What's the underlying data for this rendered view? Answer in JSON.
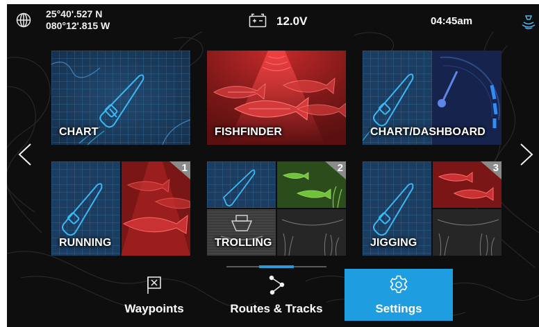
{
  "status": {
    "latitude": "25°40'.527 N",
    "longitude": "080°12'.815 W",
    "voltage": "12.0V",
    "time": "04:45am",
    "icons": [
      "globe-icon",
      "battery-icon",
      "sonar-status-icon"
    ]
  },
  "apps": [
    {
      "label": "CHART",
      "type": "chart"
    },
    {
      "label": "FISHFINDER",
      "type": "fishfinder"
    },
    {
      "label": "CHART/DASHBOARD",
      "type": "chart-dashboard"
    },
    {
      "label": "RUNNING",
      "type": "combo",
      "number": "1"
    },
    {
      "label": "TROLLING",
      "type": "combo",
      "number": "2"
    },
    {
      "label": "JIGGING",
      "type": "combo",
      "number": "3"
    }
  ],
  "nav": {
    "prev_icon": "chevron-left-icon",
    "next_icon": "chevron-right-icon",
    "page_indicator": {
      "pages": 3,
      "current": 2
    }
  },
  "bottom_bar": {
    "waypoints": "Waypoints",
    "routes": "Routes & Tracks",
    "settings": "Settings",
    "active": "settings"
  },
  "colors": {
    "chart_bg": "#1d3b5c",
    "fishfinder_bg": "#7a1818",
    "accent": "#1e9ee0",
    "boat_outline": "#39b6f2",
    "fish_green": "#5dbd2b"
  }
}
